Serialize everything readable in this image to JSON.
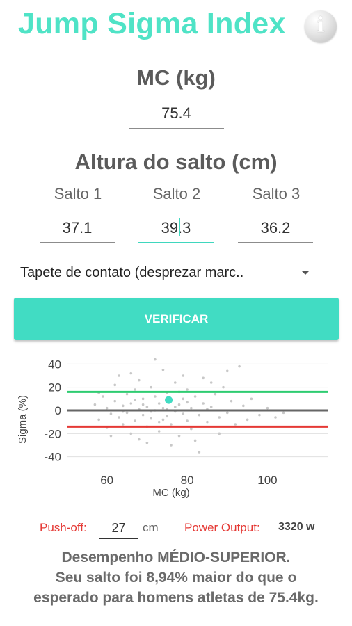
{
  "app": {
    "title": "Jump Sigma Index",
    "info_icon": "info-icon"
  },
  "mass": {
    "label": "MC (kg)",
    "value": "75.4"
  },
  "jump": {
    "heading": "Altura do salto (cm)",
    "fields": [
      {
        "label": "Salto 1",
        "value": "37.1"
      },
      {
        "label": "Salto 2",
        "value": "39.3"
      },
      {
        "label": "Salto 3",
        "value": "36.2"
      }
    ]
  },
  "method_select": {
    "selected": "Tapete de contato (desprezar marc.."
  },
  "verify_button": "VERIFICAR",
  "colors": {
    "accent": "#41dcc3",
    "upper_line": "#2ecc71",
    "lower_line": "#e53935",
    "mean_line": "#666666",
    "points": "#c8c8c8",
    "athlete_point": "#41dcc3"
  },
  "chart_data": {
    "type": "scatter",
    "xlabel": "MC (kg)",
    "ylabel": "Sigma (%)",
    "xlim": [
      50,
      115
    ],
    "ylim": [
      -45,
      45
    ],
    "x_ticks": [
      "60",
      "80",
      "100"
    ],
    "x_tick_values": [
      60,
      80,
      100
    ],
    "y_ticks": [
      "40",
      "20",
      "0",
      "-20",
      "-40"
    ],
    "y_tick_values": [
      40,
      20,
      0,
      -20,
      -40
    ],
    "reference_lines": [
      {
        "y": 16,
        "color": "#2ecc71"
      },
      {
        "y": 0,
        "color": "#666666"
      },
      {
        "y": -14,
        "color": "#e53935"
      }
    ],
    "athlete_point": {
      "x": 75.4,
      "y": 8.94
    },
    "population": [
      [
        57,
        5
      ],
      [
        58,
        -8
      ],
      [
        59,
        12
      ],
      [
        60,
        2
      ],
      [
        60,
        -15
      ],
      [
        61,
        -3
      ],
      [
        62,
        8
      ],
      [
        62,
        22
      ],
      [
        63,
        -6
      ],
      [
        63,
        30
      ],
      [
        64,
        4
      ],
      [
        64,
        -12
      ],
      [
        65,
        14
      ],
      [
        65,
        -2
      ],
      [
        66,
        -20
      ],
      [
        66,
        6
      ],
      [
        67,
        18
      ],
      [
        67,
        -9
      ],
      [
        68,
        1
      ],
      [
        68,
        26
      ],
      [
        69,
        -4
      ],
      [
        69,
        10
      ],
      [
        70,
        -14
      ],
      [
        70,
        3
      ],
      [
        71,
        20
      ],
      [
        71,
        -7
      ],
      [
        72,
        0
      ],
      [
        72,
        12
      ],
      [
        73,
        -18
      ],
      [
        73,
        6
      ],
      [
        74,
        2
      ],
      [
        74,
        35
      ],
      [
        75,
        -5
      ],
      [
        75,
        15
      ],
      [
        76,
        8
      ],
      [
        76,
        -12
      ],
      [
        77,
        -1
      ],
      [
        77,
        24
      ],
      [
        78,
        5
      ],
      [
        78,
        -22
      ],
      [
        79,
        10
      ],
      [
        79,
        -3
      ],
      [
        80,
        -9
      ],
      [
        80,
        18
      ],
      [
        81,
        2
      ],
      [
        81,
        -16
      ],
      [
        82,
        12
      ],
      [
        83,
        -4
      ],
      [
        84,
        28
      ],
      [
        84,
        6
      ],
      [
        85,
        -10
      ],
      [
        86,
        3
      ],
      [
        87,
        14
      ],
      [
        88,
        -6
      ],
      [
        89,
        20
      ],
      [
        90,
        -2
      ],
      [
        91,
        8
      ],
      [
        92,
        -12
      ],
      [
        93,
        38
      ],
      [
        94,
        4
      ],
      [
        95,
        -8
      ],
      [
        96,
        10
      ],
      [
        98,
        -4
      ],
      [
        100,
        2
      ],
      [
        102,
        -6
      ],
      [
        104,
        -2
      ],
      [
        58,
        15
      ],
      [
        61,
        -22
      ],
      [
        66,
        32
      ],
      [
        70,
        -28
      ],
      [
        76,
        -30
      ],
      [
        79,
        30
      ],
      [
        83,
        -36
      ],
      [
        88,
        -20
      ],
      [
        90,
        34
      ],
      [
        64,
        -1
      ],
      [
        67,
        9
      ],
      [
        73,
        -10
      ],
      [
        78,
        16
      ],
      [
        82,
        -26
      ],
      [
        86,
        24
      ],
      [
        72,
        44
      ],
      [
        68,
        -25
      ],
      [
        74,
        -8
      ],
      [
        77,
        3
      ],
      [
        71,
        -1
      ],
      [
        69,
        5
      ],
      [
        75,
        1
      ],
      [
        80,
        7
      ],
      [
        85,
        1
      ]
    ]
  },
  "pushoff": {
    "label": "Push-off:",
    "value": "27",
    "unit": "cm"
  },
  "power": {
    "label": "Power Output:",
    "value": "3320 w"
  },
  "result": {
    "line1": "Desempenho  MÉDIO-SUPERIOR.",
    "line2": "Seu salto foi 8,94% maior do que o",
    "line3": "esperado para homens atletas de 75.4kg."
  }
}
